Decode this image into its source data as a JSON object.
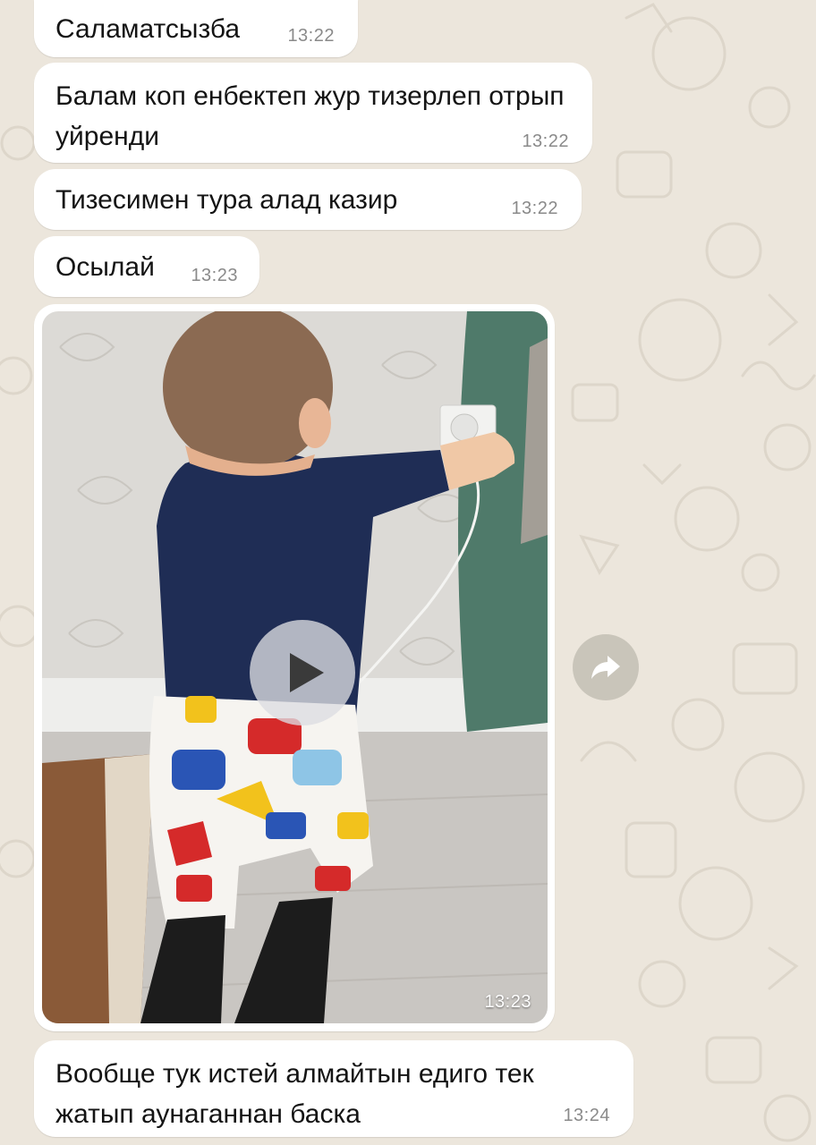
{
  "chat": {
    "messages": [
      {
        "text": "Саламатсызба",
        "time": "13:22"
      },
      {
        "text": "Балам коп енбектеп жур тизерлеп отрып уйренди",
        "time": "13:22"
      },
      {
        "text": "Тизесимен тура алад казир",
        "time": "13:22"
      },
      {
        "text": "Осылай",
        "time": "13:23"
      },
      {
        "text": "Вообще тук истей алмайтын едиго тек жатып аунаганнан баска",
        "time": "13:24"
      }
    ],
    "video": {
      "time": "13:23"
    }
  },
  "icons": {
    "play": "play-icon",
    "forward": "forward-arrow-icon"
  },
  "colors": {
    "wallpaper": "#ece6dc",
    "bubble": "#ffffff",
    "timestamp": "#8a8a8a"
  }
}
